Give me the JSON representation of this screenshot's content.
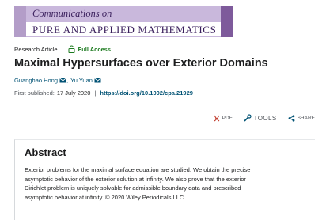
{
  "journal": {
    "line1": "Communications on",
    "line2": "PURE AND APPLIED MATHEMATICS"
  },
  "article": {
    "type": "Research Article",
    "access": "Full Access",
    "title": "Maximal Hypersurfaces over Exterior Domains",
    "authors": [
      "Guanghao Hong",
      "Yu Yuan"
    ],
    "author_separator": ",",
    "published_label": "First published:",
    "published_date": "17 July 2020",
    "separator": "|",
    "doi": "https://doi.org/10.1002/cpa.21929"
  },
  "toolbar": {
    "pdf_label": "PDF",
    "tools_label": "TOOLS",
    "share_label": "SHARE"
  },
  "abstract": {
    "heading": "Abstract",
    "lines": [
      "Exterior problems for the maximal surface equation are studied. We obtain the precise",
      "asymptotic behavior of the exterior solution at infinity. We also prove that the exterior",
      "Dirichlet problem is uniquely solvable for admissible boundary data and prescribed",
      "asymptotic behavior at infinity. © 2020 Wiley Periodicals LLC"
    ]
  },
  "colors": {
    "link": "#005274",
    "access_green": "#1b7a1e",
    "banner_light": "#c9b8dc",
    "banner_dark": "#7e5a9b",
    "pdf_red": "#c0392b"
  },
  "icons": [
    "lock-open-icon",
    "mail-icon",
    "pdf-icon",
    "wrench-icon",
    "share-icon"
  ]
}
